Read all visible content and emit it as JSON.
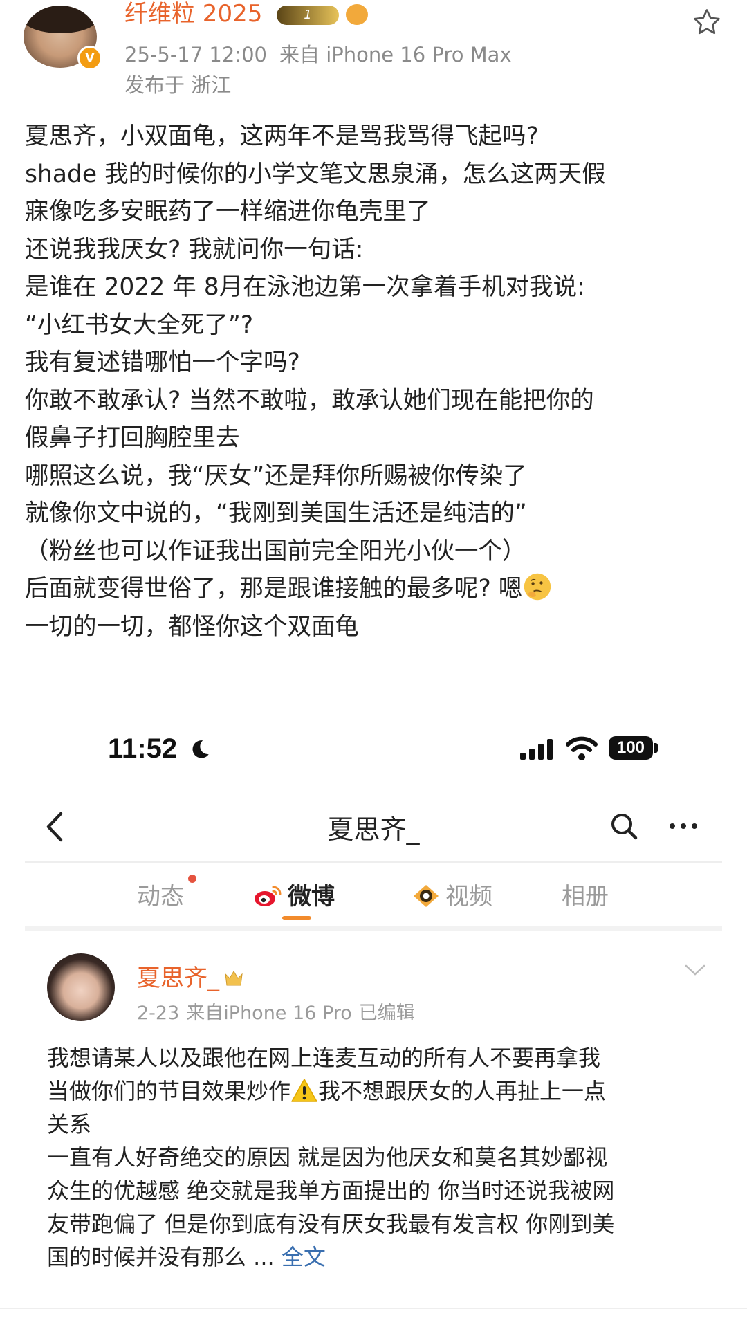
{
  "post": {
    "username": "纤维粒 2025",
    "level_badge": "1",
    "date": "25-5-17 12:00",
    "source": "来自 iPhone 16 Pro Max",
    "location": "发布于 浙江",
    "lines": [
      "夏思齐，小双面龟，这两年不是骂我骂得飞起吗?",
      "shade 我的时候你的小学文笔文思泉涌，怎么这两天假",
      "寐像吃多安眠药了一样缩进你龟壳里了",
      "还说我我厌女? 我就问你一句话:",
      "是谁在 2022 年 8月在泳池边第一次拿着手机对我说:",
      "“小红书女大全死了”?",
      "我有复述错哪怕一个字吗?",
      "你敢不敢承认? 当然不敢啦，敢承认她们现在能把你的",
      "假鼻子打回胸腔里去",
      "哪照这么说，我“厌女”还是拜你所赐被你传染了",
      "就像你文中说的，“我刚到美国生活还是纯洁的”",
      "（粉丝也可以作证我出国前完全阳光小伙一个）",
      "后面就变得世俗了，那是跟谁接触的最多呢? 嗯",
      "一切的一切，都怪你这个双面龟"
    ]
  },
  "embedded": {
    "status_bar": {
      "time": "11:52",
      "battery": "100"
    },
    "nav": {
      "title": "夏思齐_"
    },
    "tabs": [
      {
        "label": "动态"
      },
      {
        "label": "微博"
      },
      {
        "label": "视频"
      },
      {
        "label": "相册"
      }
    ],
    "post": {
      "username": "夏思齐_",
      "date": "2-23",
      "source": "来自iPhone 16 Pro",
      "edited": "已编辑",
      "lines": [
        "我想请某人以及跟他在网上连麦互动的所有人不要再拿我",
        "当做你们的节目效果炒作",
        "我不想跟厌女的人再扯上一点",
        "关系",
        "一直有人好奇绝交的原因 就是因为他厌女和莫名其妙鄙视",
        "众生的优越感 绝交就是我单方面提出的 你当时还说我被网",
        "友带跑偏了 但是你到底有没有厌女我最有发言权 你刚到美",
        "国的时候并没有那么 ..."
      ],
      "full_text_link": "全文"
    }
  },
  "colors": {
    "username": "#e8632b",
    "meta": "#8a8a8a",
    "link": "#3a6fb0",
    "tab_indicator": "#f28b2c"
  }
}
